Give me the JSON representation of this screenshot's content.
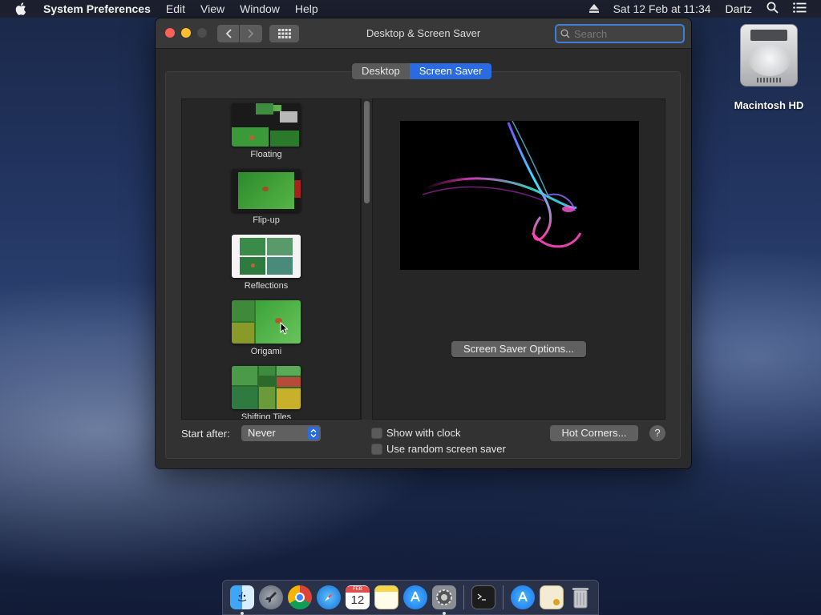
{
  "menubar": {
    "apple_icon": "apple-logo-icon",
    "app_name": "System Preferences",
    "menus": [
      "Edit",
      "View",
      "Window",
      "Help"
    ],
    "clock": "Sat 12 Feb at  11:34",
    "user": "Dartz",
    "status_icons": [
      "eject-icon",
      "spotlight-search-icon",
      "notification-center-icon"
    ]
  },
  "desktop": {
    "drive_label": "Macintosh HD"
  },
  "window": {
    "title": "Desktop & Screen Saver",
    "search_placeholder": "Search",
    "tabs": [
      {
        "label": "Desktop",
        "active": false
      },
      {
        "label": "Screen Saver",
        "active": true
      }
    ]
  },
  "screen_savers": [
    {
      "label": "Floating"
    },
    {
      "label": "Flip-up"
    },
    {
      "label": "Reflections"
    },
    {
      "label": "Origami"
    },
    {
      "label": "Shifting Tiles"
    }
  ],
  "preview": {
    "options_button": "Screen Saver Options..."
  },
  "controls": {
    "start_after_label": "Start after:",
    "start_after_value": "Never",
    "show_with_clock": "Show with clock",
    "show_with_clock_checked": false,
    "random_saver": "Use random screen saver",
    "random_saver_checked": false,
    "hot_corners": "Hot Corners...",
    "help": "?"
  },
  "calendar_date": "12",
  "calendar_month": "FEB",
  "dock": [
    "finder",
    "launchpad",
    "chrome",
    "safari",
    "calendar",
    "notes",
    "app-store",
    "system-preferences",
    "terminal",
    "app-store-downloads",
    "certificate",
    "trash"
  ]
}
